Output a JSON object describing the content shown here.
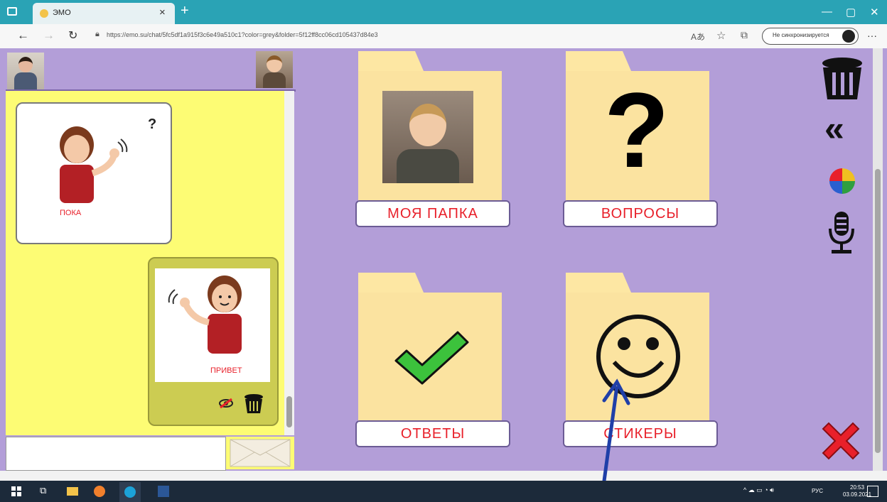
{
  "browser": {
    "tab_title": "ЭМО",
    "tab_close": "×",
    "new_tab": "+",
    "url": "https://emo.su/chat/5fc5df1a915f3c6e49a510c1?color=grey&folder=5f12ff8cc06cd105437d84e3",
    "sync_label": "Не синхронизируется",
    "menu": "···"
  },
  "chat": {
    "message_in_label": "ПОКА",
    "message_in_symbol": "?",
    "message_out_label": "ПРИВЕТ"
  },
  "folders": [
    {
      "label": "МОЯ ПАПКА"
    },
    {
      "label": "ВОПРОСЫ"
    },
    {
      "label": "ОТВЕТЫ"
    },
    {
      "label": "СТИКЕРЫ"
    }
  ],
  "taskbar": {
    "time": "20:53",
    "date": "03.09.2021",
    "lang": "РУС"
  },
  "colors": {
    "accent_red": "#e8202a",
    "panel_purple": "#b39ed8",
    "chat_yellow": "#fdfc74",
    "folder": "#fde7a3",
    "arrow_blue": "#1f3fa8"
  }
}
